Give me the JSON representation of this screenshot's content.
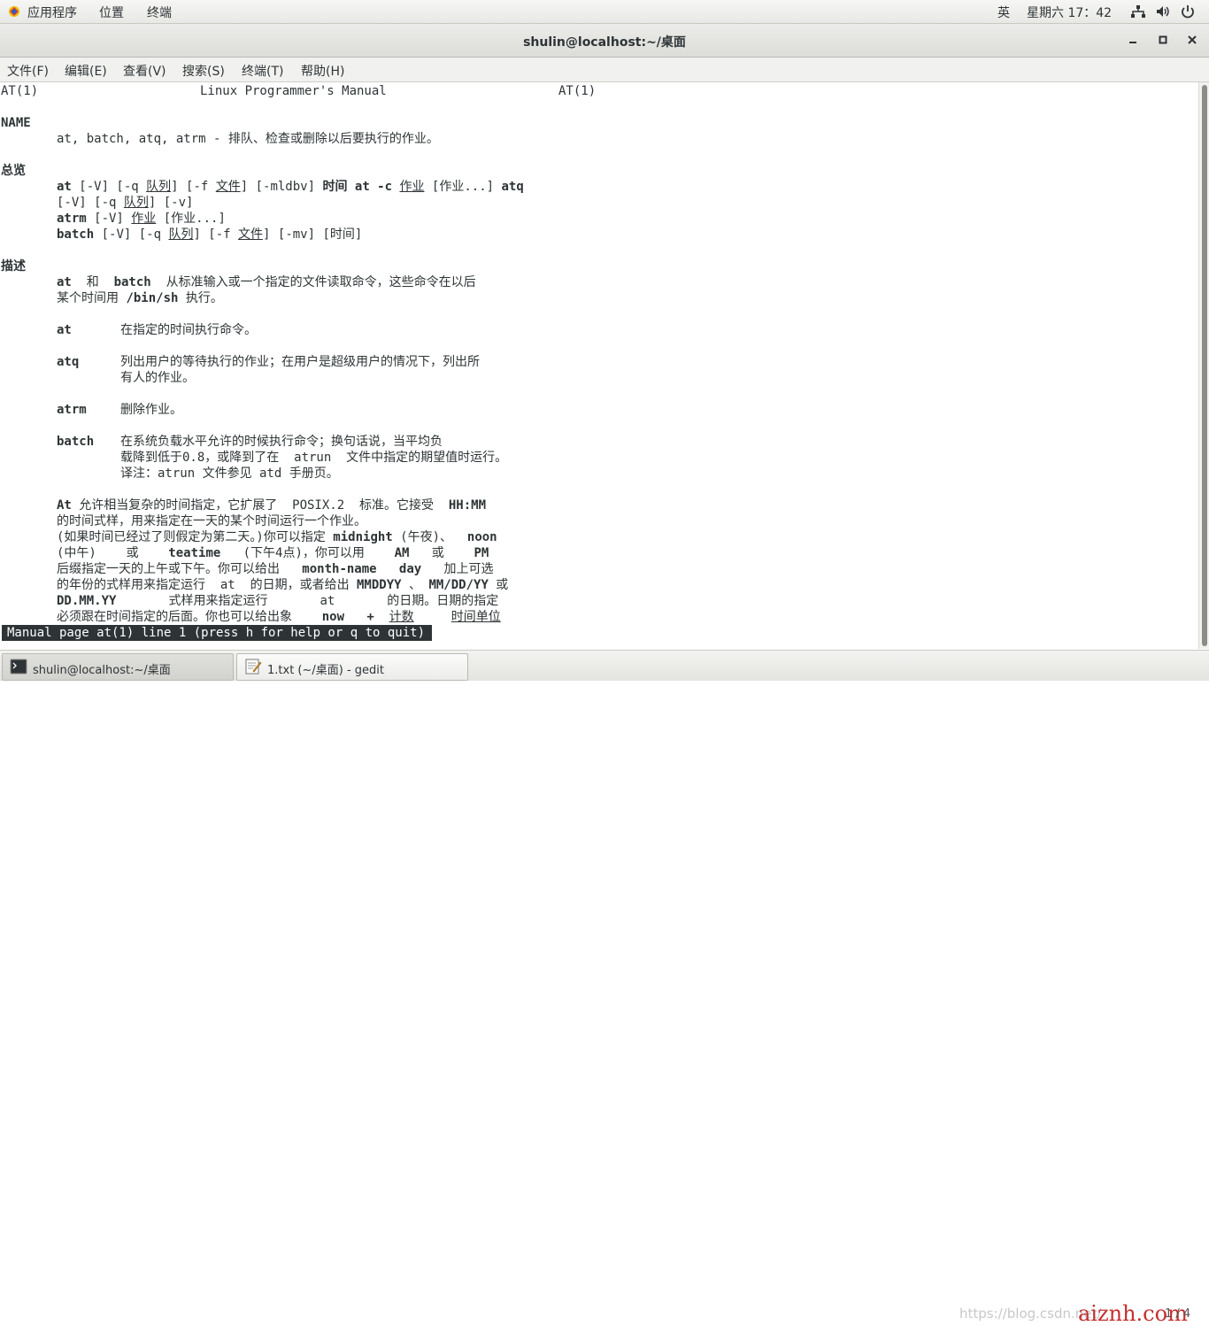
{
  "topbar": {
    "apps_label": "应用程序",
    "places_label": "位置",
    "terminal_label": "终端",
    "input_method": "英",
    "clock": "星期六 17：42"
  },
  "window": {
    "title": "shulin@localhost:~/桌面"
  },
  "menubar": [
    "文件(F)",
    "编辑(E)",
    "查看(V)",
    "搜索(S)",
    "终端(T)",
    "帮助(H)"
  ],
  "man": {
    "header_left": "AT(1)",
    "header_center": "Linux Programmer's Manual",
    "header_right": "AT(1)",
    "name_heading": "NAME",
    "name_text": "at, batch, atq, atrm - 排队、检查或删除以后要执行的作业。",
    "synopsis_heading": "总览",
    "syn1_at": "at",
    "syn1_a": " [-V] [-q ",
    "syn1_queue": "队列",
    "syn1_b": "] [-f ",
    "syn1_file": "文件",
    "syn1_c": "] [-mldbv] ",
    "syn1_time": "时间",
    "syn1_sp": " ",
    "syn1_atc": "at -c",
    "syn1_d": " ",
    "syn1_job": "作业",
    "syn1_e": " [作业...] ",
    "syn1_atq": "atq",
    "syn2_a": "[-V] [-q ",
    "syn2_queue": "队列",
    "syn2_b": "] [-v]",
    "syn3_atrm": "atrm",
    "syn3_a": " [-V] ",
    "syn3_job": "作业",
    "syn3_b": " [作业...]",
    "syn4_batch": "batch",
    "syn4_a": " [-V] [-q ",
    "syn4_queue": "队列",
    "syn4_b": "] [-f ",
    "syn4_file": "文件",
    "syn4_c": "] [-mv] [时间]",
    "desc_heading": "描述",
    "desc1_at": "at",
    "desc1_and": "  和  ",
    "desc1_batch": "batch",
    "desc1_rest": "  从标准输入或一个指定的文件读取命令，这些命令在以后",
    "desc2_a": "某个时间用 ",
    "desc2_binsh": "/bin/sh",
    "desc2_b": " 执行。",
    "item_at": "at",
    "item_at_text": "在指定的时间执行命令。",
    "item_atq": "atq",
    "item_atq_text1": "列出用户的等待执行的作业；在用户是超级用户的情况下，列出所",
    "item_atq_text2": "有人的作业。",
    "item_atrm": "atrm",
    "item_atrm_text": "删除作业。",
    "item_batch": "batch",
    "item_batch_text1": "在系统负载水平允许的时候执行命令；换句话说，当平均负",
    "item_batch_text2": "载降到低于0.8，或降到了在  atrun  文件中指定的期望值时运行。",
    "item_batch_text3": "译注：atrun 文件参见 atd 手册页。",
    "p1_At": "At",
    "p1_a": " 允许相当复杂的时间指定，它扩展了  POSIX.2  标准。它接受  ",
    "p1_hhmm": "HH:MM",
    "p2": "的时间式样，用来指定在一天的某个时间运行一个作业。",
    "p3_a": "(如果时间已经过了则假定为第二天。)你可以指定 ",
    "p3_midnight": "midnight",
    "p3_b": " (午夜)、  ",
    "p3_noon": "noon",
    "p4_a": "(中午)    或    ",
    "p4_teatime": "teatime",
    "p4_b": "   (下午4点)，你可以用    ",
    "p4_am": "AM",
    "p4_c": "   或    ",
    "p4_pm": "PM",
    "p5_a": "后缀指定一天的上午或下午。你可以给出   ",
    "p5_month": "month-name",
    "p5_b": "   ",
    "p5_day": "day",
    "p5_c": "   加上可选",
    "p6_a": "的年份的式样用来指定运行  at  的日期，或者给出 ",
    "p6_mmddyy": "MMDDYY",
    "p6_b": " 、 ",
    "p6_mmddyy2": "MM/DD/YY",
    "p6_c": " 或",
    "p7_ddmmyy": "DD.MM.YY",
    "p7_a": "       式样用来指定运行       at       的日期。日期的指定",
    "p8_a": "必须跟在时间指定的后面。你也可以给出象    ",
    "p8_now": "now",
    "p8_b": "   ",
    "p8_plus": "+",
    "p8_c": "  ",
    "p8_count": "计数",
    "p8_d": "     ",
    "p8_unit": "时间单位",
    "status": "Manual page at(1) line 1 (press h for help or q to quit)"
  },
  "taskbar": {
    "task1": "shulin@localhost:~/桌面",
    "task2": "1.txt (~/桌面) - gedit",
    "watermark": "https://blog.csdn.net/",
    "watermark2": "aiznh.com",
    "page": "1 / 4"
  }
}
